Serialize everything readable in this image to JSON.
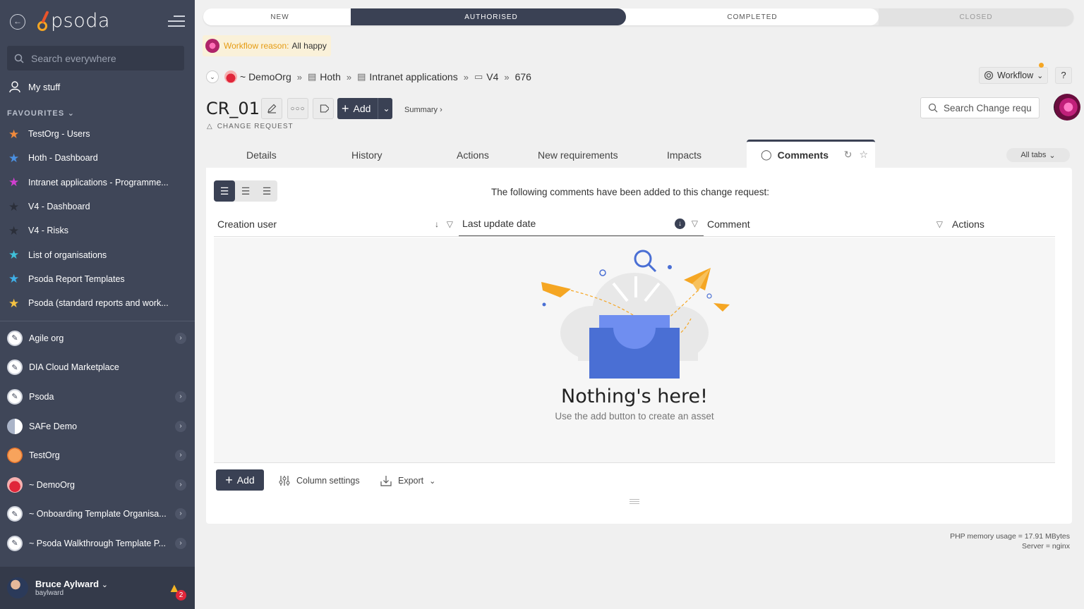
{
  "sidebar": {
    "logo_text": "psoda",
    "search_placeholder": "Search everywhere",
    "my_stuff": "My stuff",
    "favourites_title": "FAVOURITES",
    "favourites": [
      {
        "label": "TestOrg - Users",
        "color": "#f08a3c"
      },
      {
        "label": "Hoth - Dashboard",
        "color": "#4a90e2"
      },
      {
        "label": "Intranet applications - Programme...",
        "color": "#d23fd0"
      },
      {
        "label": "V4 - Dashboard",
        "color": "#2b2f3a"
      },
      {
        "label": "V4 - Risks",
        "color": "#2b2f3a"
      },
      {
        "label": "List of organisations",
        "color": "#3fc1d9"
      },
      {
        "label": "Psoda Report Templates",
        "color": "#3fb0e8"
      },
      {
        "label": "Psoda (standard reports and work...",
        "color": "#f5c242"
      }
    ],
    "orgs": [
      {
        "label": "Agile org",
        "icon": "pen",
        "chevron": true
      },
      {
        "label": "DIA Cloud Marketplace",
        "icon": "pen",
        "chevron": false
      },
      {
        "label": "Psoda",
        "icon": "pen",
        "chevron": true
      },
      {
        "label": "SAFe Demo",
        "icon": "safe",
        "chevron": true
      },
      {
        "label": "TestOrg",
        "icon": "test",
        "chevron": true
      },
      {
        "label": "~ DemoOrg",
        "icon": "demo",
        "chevron": true
      },
      {
        "label": "~ Onboarding Template Organisa...",
        "icon": "pen",
        "chevron": true
      },
      {
        "label": "~ Psoda Walkthrough Template P...",
        "icon": "pen",
        "chevron": true
      }
    ],
    "user": {
      "name": "Bruce Aylward",
      "login": "baylward",
      "notifications": "2"
    }
  },
  "workflow": {
    "steps": [
      "NEW",
      "AUTHORISED",
      "COMPLETED",
      "CLOSED"
    ],
    "reason_label": "Workflow reason:",
    "reason_value": "All happy",
    "button_label": "Workflow"
  },
  "breadcrumb": {
    "org": "~ DemoOrg",
    "items": [
      "Hoth",
      "Intranet applications",
      "V4",
      "676"
    ]
  },
  "header": {
    "title": "CR_01",
    "type": "CHANGE REQUEST",
    "add_label": "Add",
    "summary_label": "Summary",
    "search_placeholder": "Search Change requ",
    "help_label": "?"
  },
  "tabs": {
    "items": [
      "Details",
      "History",
      "Actions",
      "New requirements",
      "Impacts"
    ],
    "active": "Comments",
    "all_tabs": "All tabs"
  },
  "panel": {
    "intro": "The following comments have been added to this change request:",
    "columns": [
      "Creation user",
      "Last update date",
      "Comment",
      "Actions"
    ],
    "empty_title": "Nothing's here!",
    "empty_sub": "Use the add button to create an asset",
    "add_label": "Add",
    "column_settings": "Column settings",
    "export_label": "Export"
  },
  "footer": {
    "memory": "PHP memory usage = 17.91 MBytes",
    "server": "Server = nginx"
  }
}
